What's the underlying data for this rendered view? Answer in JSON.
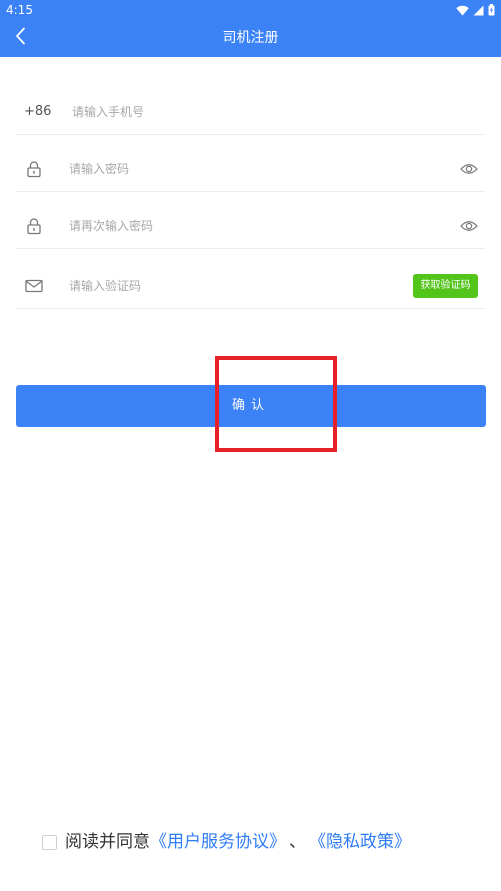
{
  "status_bar": {
    "time": "4:15"
  },
  "nav": {
    "title": "司机注册"
  },
  "form": {
    "phone": {
      "prefix": "+86",
      "placeholder": "请输入手机号",
      "value": ""
    },
    "password": {
      "placeholder": "请输入密码",
      "value": ""
    },
    "confirm_password": {
      "placeholder": "请再次输入密码",
      "value": ""
    },
    "verification": {
      "placeholder": "请输入验证码",
      "value": "",
      "get_code_label": "获取验证码"
    }
  },
  "confirm_label": "确认",
  "agreement": {
    "checked": false,
    "prefix_text": "阅读并同意",
    "user_agreement_link": "《用户服务协议》",
    "separator": "、",
    "privacy_link": "《隐私政策》"
  },
  "colors": {
    "primary": "#3b82f6",
    "accent_green": "#52c41a",
    "link": "#2f7df6",
    "highlight": "#e8202a"
  },
  "icons": {
    "back": "chevron-left-icon",
    "lock": "lock-icon",
    "eye": "eye-icon",
    "mail": "mail-icon",
    "wifi": "wifi-icon",
    "signal": "signal-icon",
    "battery": "battery-icon"
  }
}
